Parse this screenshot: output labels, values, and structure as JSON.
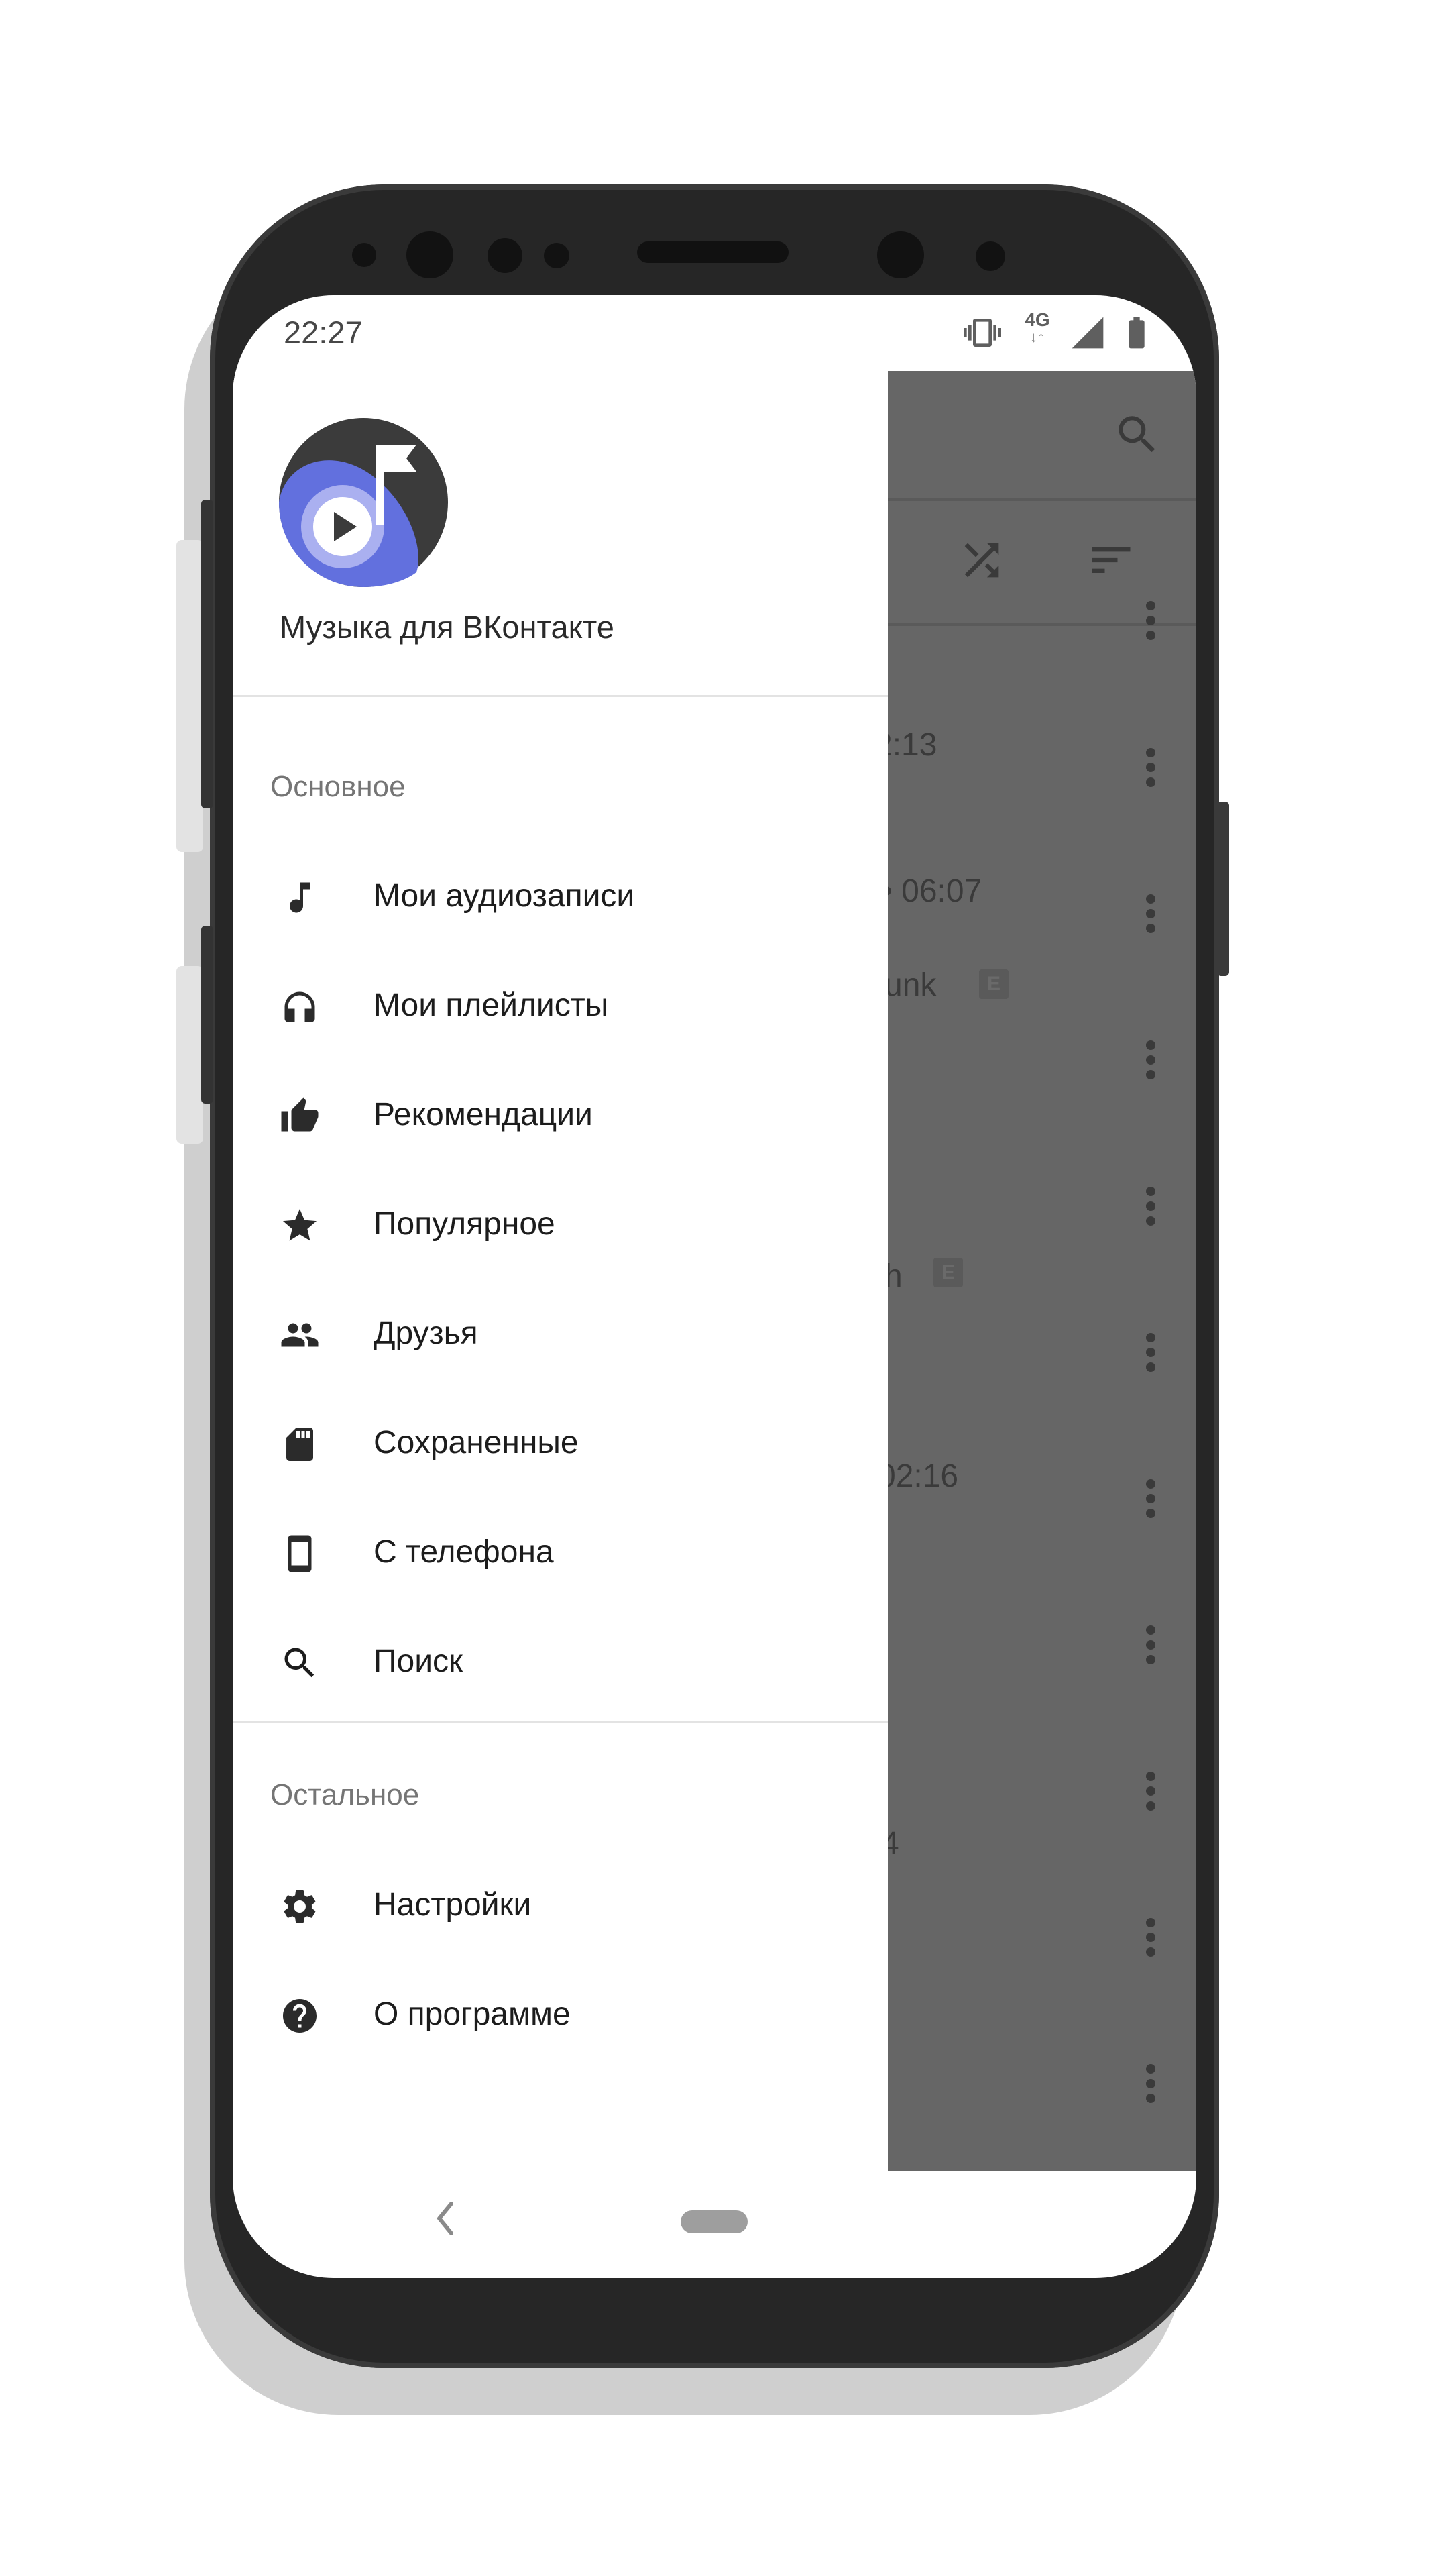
{
  "status_bar": {
    "time": "22:27",
    "network": "4G",
    "icons": [
      "vibrate-icon",
      "network-4g-icon",
      "signal-icon",
      "battery-icon"
    ]
  },
  "drawer": {
    "app_name": "Музыка для ВКонтакте",
    "sections": [
      {
        "title": "Основное",
        "items": [
          {
            "label": "Мои аудиозаписи",
            "icon": "music-note-icon"
          },
          {
            "label": "Мои плейлисты",
            "icon": "headphones-icon"
          },
          {
            "label": "Рекомендации",
            "icon": "thumb-up-icon"
          },
          {
            "label": "Популярное",
            "icon": "star-icon"
          },
          {
            "label": "Друзья",
            "icon": "people-icon"
          },
          {
            "label": "Сохраненные",
            "icon": "sd-card-icon"
          },
          {
            "label": "С телефона",
            "icon": "smartphone-icon"
          },
          {
            "label": "Поиск",
            "icon": "search-icon"
          }
        ]
      },
      {
        "title": "Остальное",
        "items": [
          {
            "label": "Настройки",
            "icon": "settings-icon"
          },
          {
            "label": "О программе",
            "icon": "help-icon"
          }
        ]
      }
    ]
  },
  "background_list": {
    "fragments": [
      "2:13",
      "• 06:07",
      "unk",
      "h",
      "02:16",
      "4"
    ],
    "badge": "E"
  },
  "colors": {
    "logo_blue": "#6270de",
    "logo_dark": "#3b3b3b",
    "scrim": "#666666"
  }
}
